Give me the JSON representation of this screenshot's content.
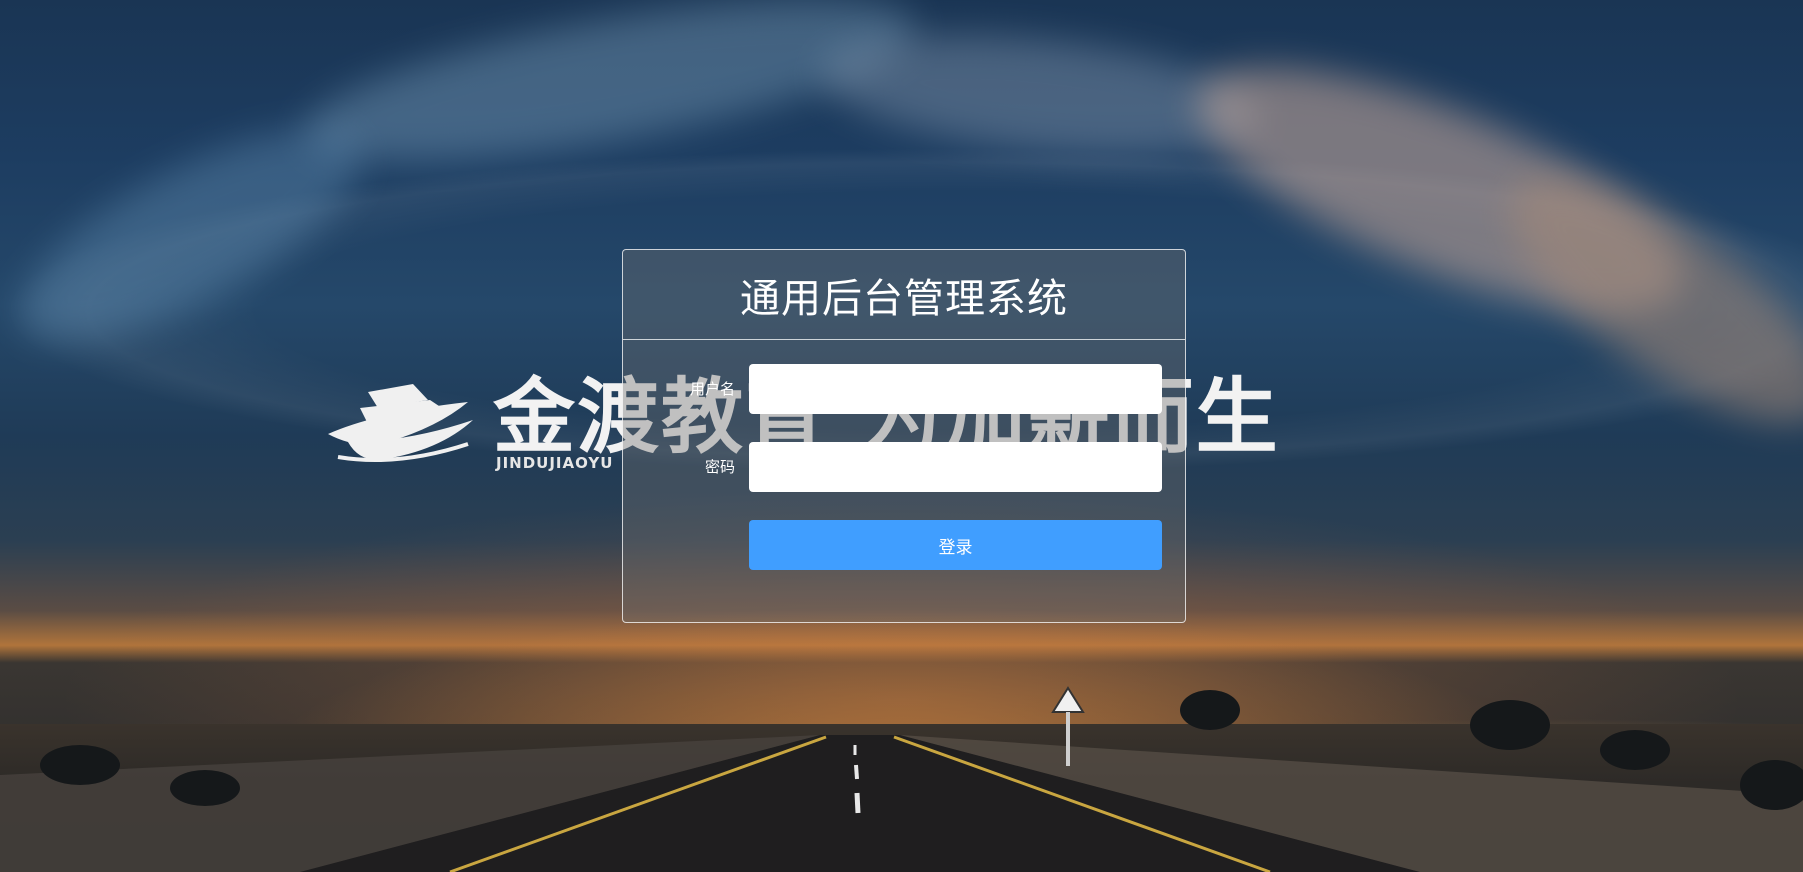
{
  "brand": {
    "name": "金渡教育",
    "slogan": "为加薪而生",
    "subtitle": "JINDUJIAOYU"
  },
  "login": {
    "title": "通用后台管理系统",
    "username_label": "用户名",
    "username_value": "",
    "password_label": "密码",
    "password_value": "",
    "submit_label": "登录"
  },
  "colors": {
    "accent": "#409eff"
  }
}
